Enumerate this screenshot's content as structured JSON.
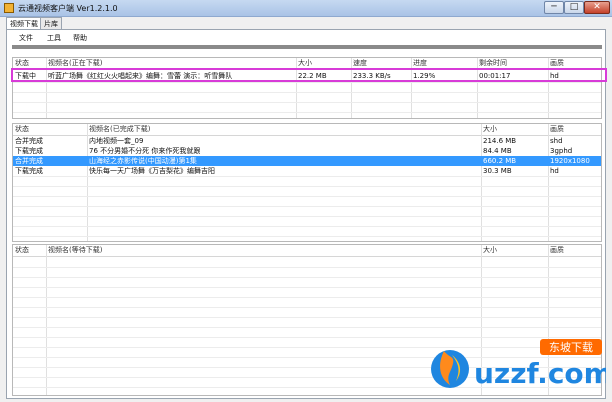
{
  "window": {
    "title": "云通视频客户端   Ver1.2.1.0",
    "min": "─",
    "max": "□",
    "close": "✕"
  },
  "tabs": [
    "视频下载",
    "片库"
  ],
  "menu": [
    "文件",
    "工具",
    "帮助"
  ],
  "downloading": {
    "headers": [
      "状态",
      "视频名(正在下载)",
      "大小",
      "速度",
      "进度",
      "剩余时间",
      "画质"
    ],
    "rows": [
      [
        "下载中",
        "听蓝广场舞《红红火火唱起来》编舞：雪蕾 演示：听雪舞队",
        "22.2 MB",
        "233.3 KB/s",
        "1.29%",
        "00:01:17",
        "hd"
      ]
    ]
  },
  "completed": {
    "headers": [
      "状态",
      "视频名(已完成下载)",
      "大小",
      "画质"
    ],
    "rows": [
      [
        "合并完成",
        "内地视频一套_09",
        "214.6 MB",
        "shd"
      ],
      [
        "下载完成",
        "76 不分男婚不分死 你来作死我就跟",
        "84.4 MB",
        "3gphd"
      ],
      [
        "合并完成",
        "山海经之赤影传说(中国动漫)第1集",
        "660.2 MB",
        "1920x1080"
      ],
      [
        "下载完成",
        "快乐每一天广场舞《万吉梨花》编舞吉阳",
        "30.3 MB",
        "hd"
      ]
    ]
  },
  "queued": {
    "headers": [
      "状态",
      "视频名(等待下载)",
      "大小",
      "画质"
    ],
    "rows": []
  },
  "watermark": {
    "badge": "东坡下载",
    "brand": "uzzf.com"
  }
}
